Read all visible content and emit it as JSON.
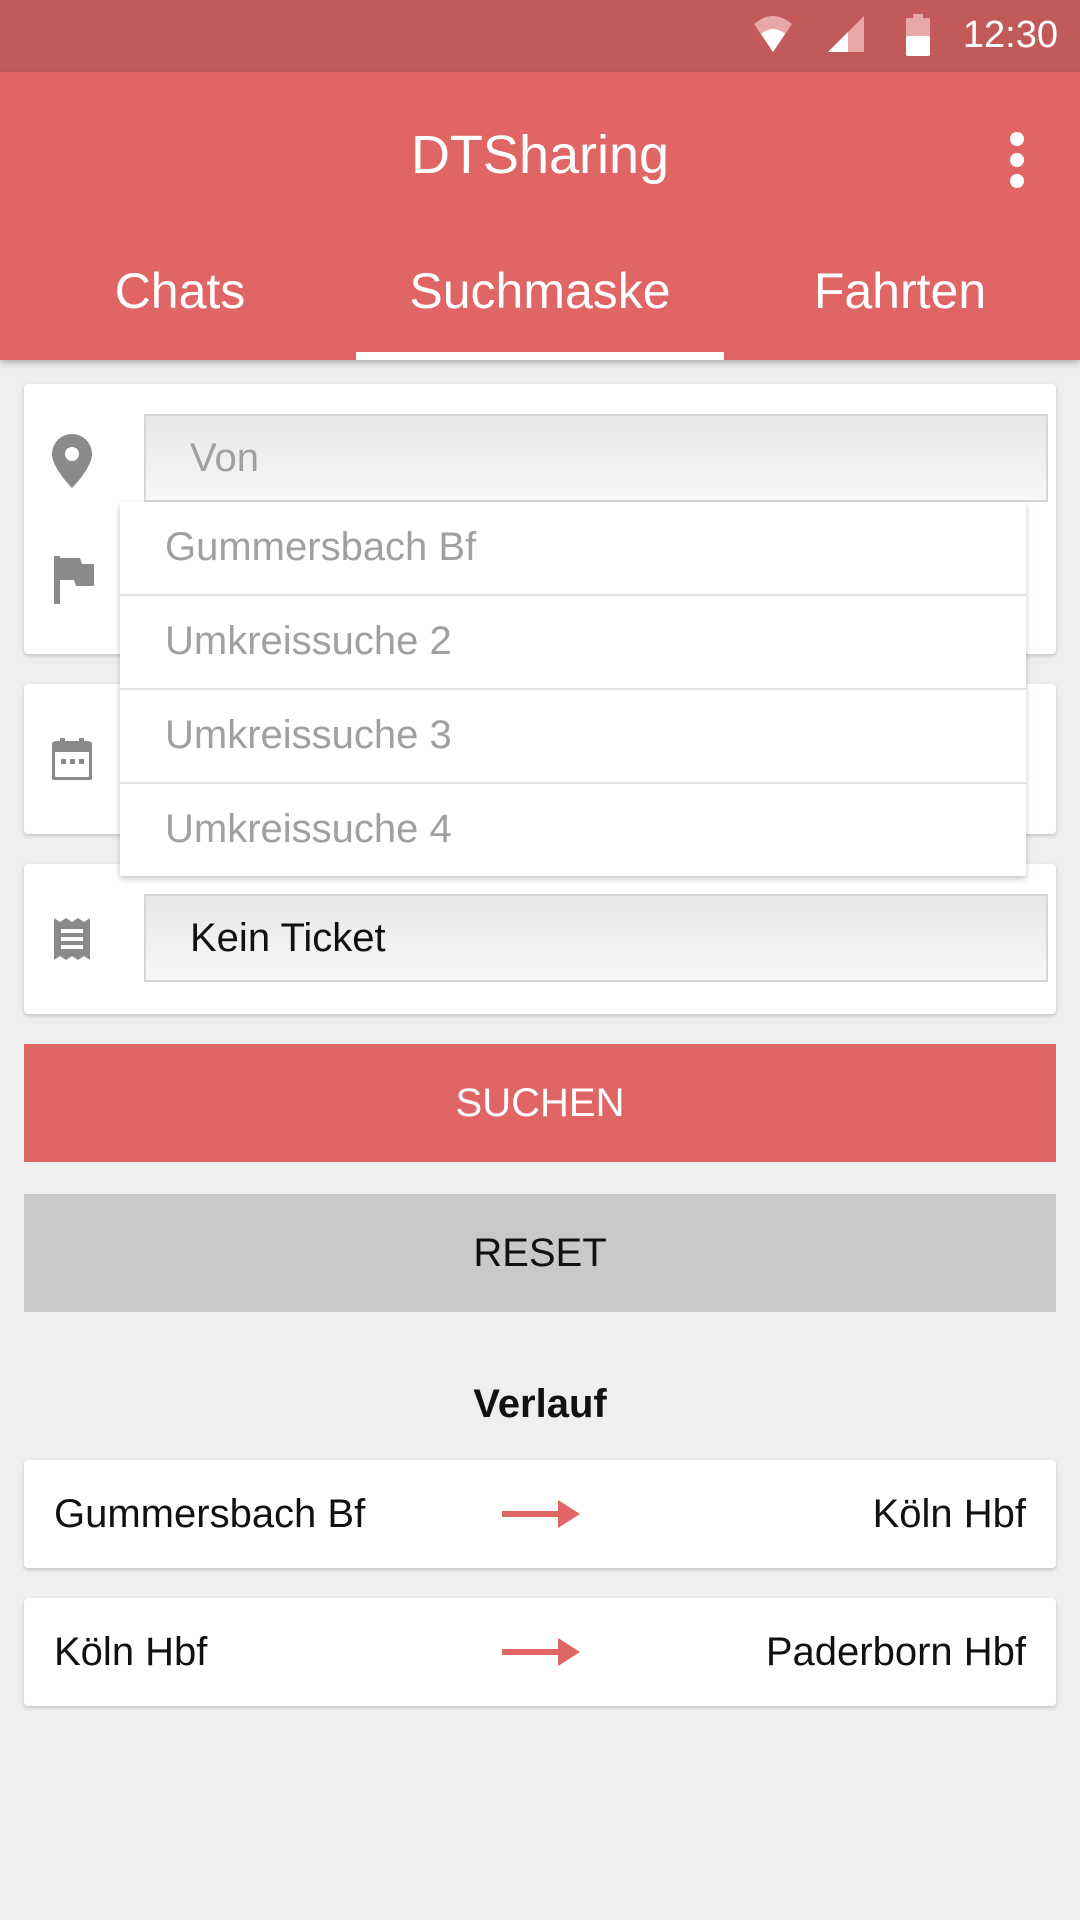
{
  "status_bar": {
    "time": "12:30"
  },
  "app_bar": {
    "title": "DTSharing"
  },
  "tabs": [
    {
      "label": "Chats",
      "selected": false
    },
    {
      "label": "Suchmaske",
      "selected": true
    },
    {
      "label": "Fahrten",
      "selected": false
    }
  ],
  "form": {
    "from_placeholder": "Von",
    "ticket_value": "Kein Ticket"
  },
  "autocomplete": {
    "items": [
      "Gummersbach Bf",
      "Umkreissuche 2",
      "Umkreissuche 3",
      "Umkreissuche 4"
    ]
  },
  "buttons": {
    "search": "SUCHEN",
    "reset": "RESET"
  },
  "history": {
    "title": "Verlauf",
    "entries": [
      {
        "from": "Gummersbach Bf",
        "to": "Köln Hbf"
      },
      {
        "from": "Köln Hbf",
        "to": "Paderborn Hbf"
      }
    ]
  },
  "colors": {
    "primary": "#e06666",
    "status_bar": "#c35a5a",
    "reset_button": "#c9c9c9",
    "background": "#efefef"
  },
  "icons": [
    "wifi-icon",
    "signal-icon",
    "battery-icon",
    "overflow-menu-icon",
    "location-pin-icon",
    "flag-icon",
    "calendar-icon",
    "ticket-icon",
    "arrow-right-icon"
  ]
}
